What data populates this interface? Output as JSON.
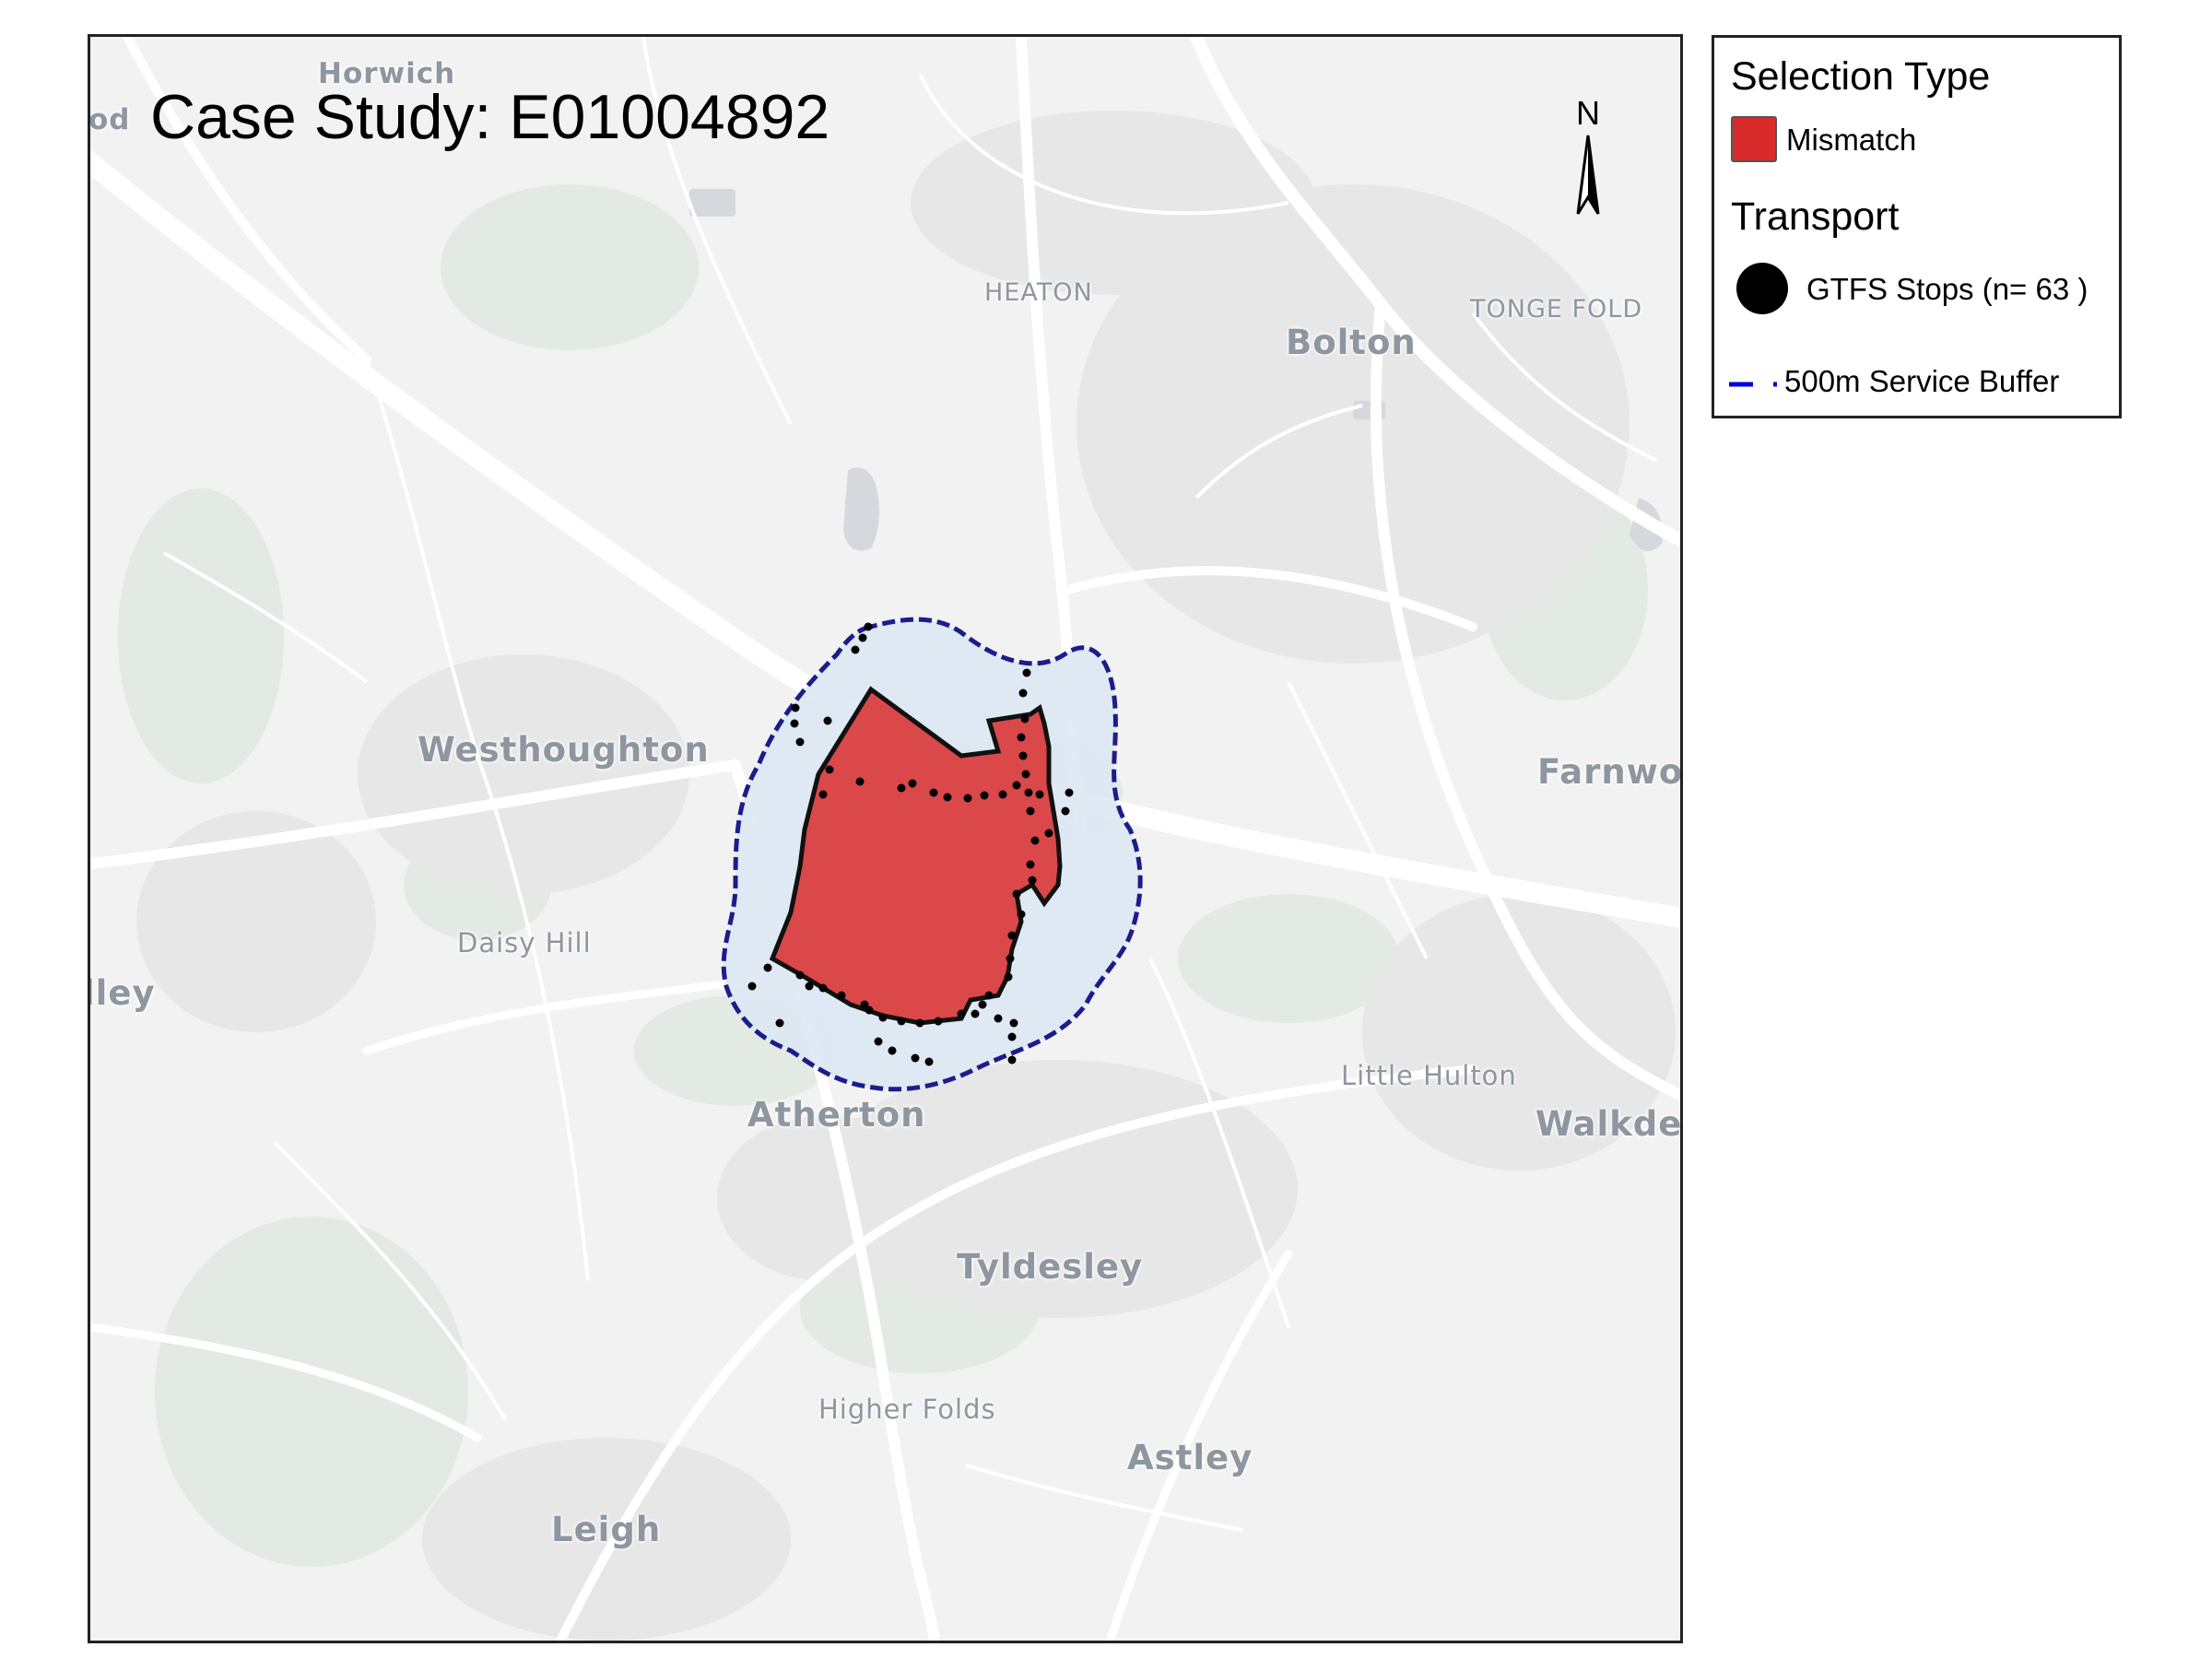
{
  "map": {
    "title": "Case Study: E01004892",
    "north_label": "N",
    "places": [
      {
        "name": "Horwich",
        "style": "medium"
      },
      {
        "name": "od",
        "style": "medium"
      },
      {
        "name": "HEATON",
        "style": "caps"
      },
      {
        "name": "Bolton",
        "style": "large"
      },
      {
        "name": "TONGE FOLD",
        "style": "caps"
      },
      {
        "name": "Westhoughton",
        "style": "large"
      },
      {
        "name": "Farnwor",
        "style": "large"
      },
      {
        "name": "Daisy Hill",
        "style": "small"
      },
      {
        "name": "lley",
        "style": "large"
      },
      {
        "name": "Little Hulton",
        "style": "small"
      },
      {
        "name": "Atherton",
        "style": "large"
      },
      {
        "name": "Walkder",
        "style": "large"
      },
      {
        "name": "Tyldesley",
        "style": "large"
      },
      {
        "name": "Higher Folds",
        "style": "small"
      },
      {
        "name": "Astley",
        "style": "large"
      },
      {
        "name": "Leigh",
        "style": "large"
      }
    ],
    "colors": {
      "mismatch_fill": "#d92b2b",
      "buffer_fill": "#dbe8f3",
      "buffer_stroke": "#1c1c8c",
      "stop": "#000000",
      "basemap": "#f1f2f1",
      "road": "#ffffff"
    }
  },
  "legend": {
    "selection_title": "Selection Type",
    "mismatch_label": "Mismatch",
    "transport_title": "Transport",
    "stops_label": "GTFS Stops (n= 63 )",
    "buffer_label": "500m Service Buffer",
    "buffer_icon": "dashed-line-icon",
    "stops_icon": "filled-circle-icon"
  }
}
